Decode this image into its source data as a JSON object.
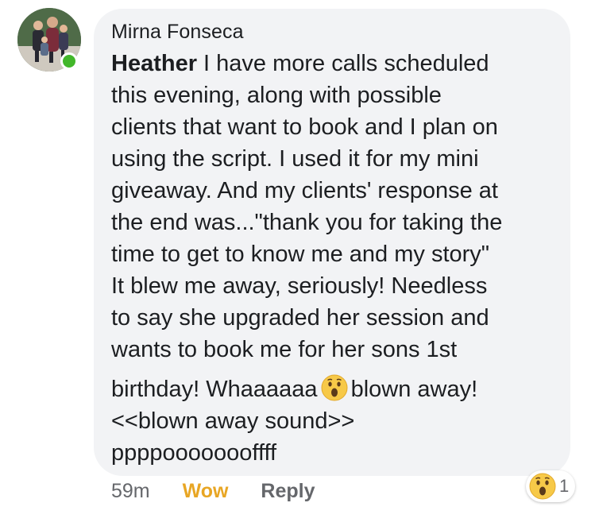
{
  "comment": {
    "author": "Mirna Fonseca",
    "mention": "Heather",
    "lines": [
      " I have more calls scheduled",
      "this evening, along with possible",
      "clients that want to book and I plan on",
      "using the script. I used it for my mini",
      "giveaway. And my clients' response at",
      "the end was...\"thank you for taking the",
      "time to get to know me and my story\"",
      "It blew me away, seriously! Needless",
      "to say she upgraded her session and",
      "wants to book me for her sons 1st"
    ],
    "line_with_emoji_before": "birthday! Whaaaaaa",
    "line_with_emoji_after": "blown away!",
    "line_12": "<<blown away sound>>",
    "line_13": "ppppoooooooffff"
  },
  "footer": {
    "time": "59m",
    "wow_label": "Wow",
    "reply_label": "Reply"
  },
  "reaction": {
    "icon": "wow-emoji-icon",
    "count": "1"
  },
  "colors": {
    "bubble": "#f2f3f5",
    "text": "#1c1e21",
    "meta": "#65676b",
    "wow": "#e8a624",
    "online": "#42b72a"
  }
}
